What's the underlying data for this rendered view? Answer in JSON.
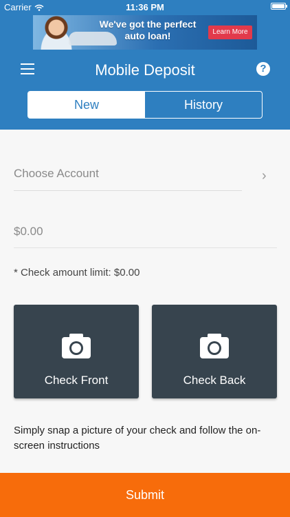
{
  "status_bar": {
    "carrier": "Carrier",
    "time": "11:36 PM"
  },
  "ad": {
    "headline": "We've got the perfect auto loan!",
    "button": "Learn More"
  },
  "header": {
    "title": "Mobile Deposit",
    "tabs": [
      {
        "label": "New",
        "active": true
      },
      {
        "label": "History",
        "active": false
      }
    ],
    "icons": [
      "menu-icon",
      "help-icon"
    ]
  },
  "form": {
    "account_placeholder": "Choose Account",
    "amount_placeholder": "$0.00",
    "limit_text": "* Check amount limit: $0.00"
  },
  "checks": {
    "front_label": "Check Front",
    "back_label": "Check Back"
  },
  "info": "Simply snap a picture of your check and follow the on-screen instructions",
  "submit_label": "Submit",
  "colors": {
    "header_blue": "#2e7fc0",
    "card_dark": "#37444e",
    "submit_orange": "#f76c0b"
  }
}
